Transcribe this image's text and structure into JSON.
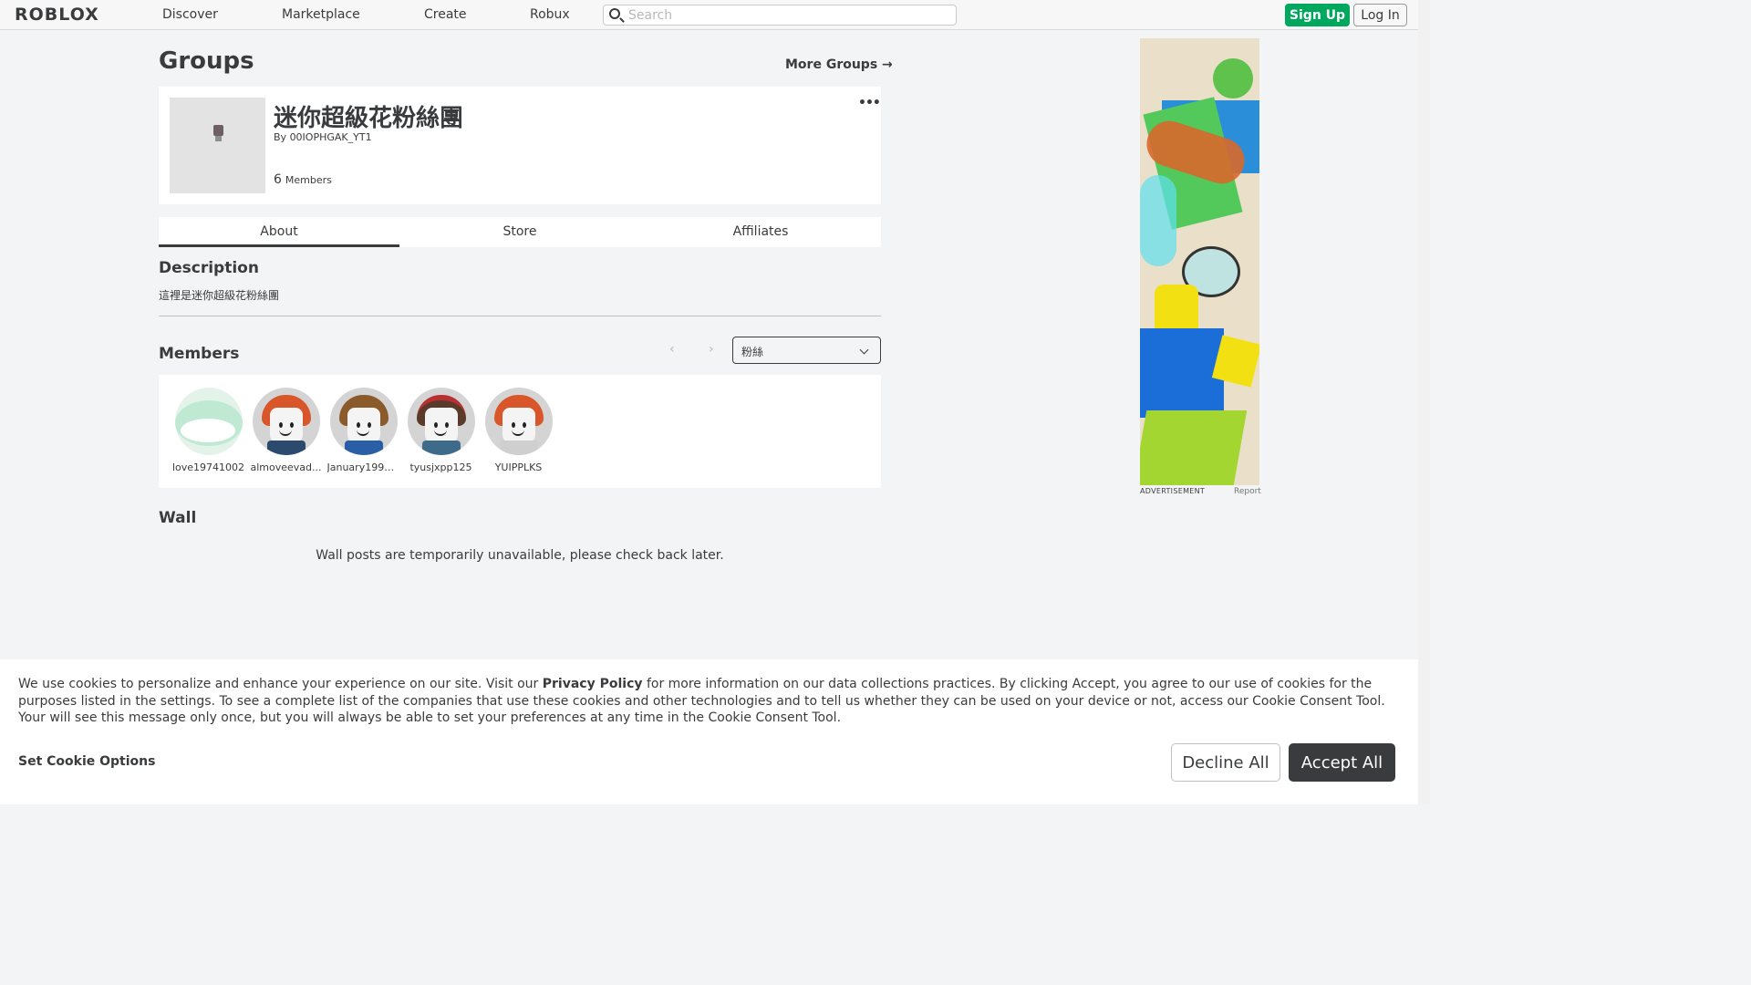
{
  "header": {
    "logo": "ROBLOX",
    "nav": [
      "Discover",
      "Marketplace",
      "Create",
      "Robux"
    ],
    "search_placeholder": "Search",
    "signup_label": "Sign Up",
    "login_label": "Log In"
  },
  "page": {
    "title": "Groups",
    "more_groups": "More Groups →"
  },
  "group": {
    "name": "迷你超級花粉絲團",
    "owner_prefix": "By",
    "owner": "00IOPHGAK_YT1",
    "member_count": "6",
    "member_label": "Members",
    "menu": "•••"
  },
  "tabs": [
    "About",
    "Store",
    "Affiliates"
  ],
  "about": {
    "description_heading": "Description",
    "description": "這裡是迷你超級花粉絲團",
    "members_heading": "Members",
    "pager_prev": "‹",
    "pager_next": "›",
    "role_selected": "粉絲",
    "members": [
      {
        "name": "love19741002"
      },
      {
        "name": "almoveevad..."
      },
      {
        "name": "January1999..."
      },
      {
        "name": "tyusjxpp125"
      },
      {
        "name": "YUIPPLKS"
      }
    ],
    "wall_heading": "Wall",
    "wall_message": "Wall posts are temporarily unavailable, please check back later."
  },
  "ad": {
    "label": "ADVERTISEMENT",
    "report": "Report"
  },
  "cookie": {
    "text_before": "We use cookies to personalize and enhance your experience on our site. Visit our ",
    "policy_link": "Privacy Policy",
    "text_after": " for more information on our data collections practices. By clicking Accept, you agree to our use of cookies for the purposes listed in the settings. To see a complete list of the companies that use these cookies and other technologies and to tell us whether they can be used on your device or not, access our Cookie Consent Tool. Your will see this message only once, but you will always be able to set your preferences at any time in the Cookie Consent Tool.",
    "options_label": "Set Cookie Options",
    "decline_label": "Decline All",
    "accept_label": "Accept All"
  },
  "colors": {
    "signup": "#00a85e",
    "accept": "#393b3d",
    "background": "#f2f4f5"
  }
}
